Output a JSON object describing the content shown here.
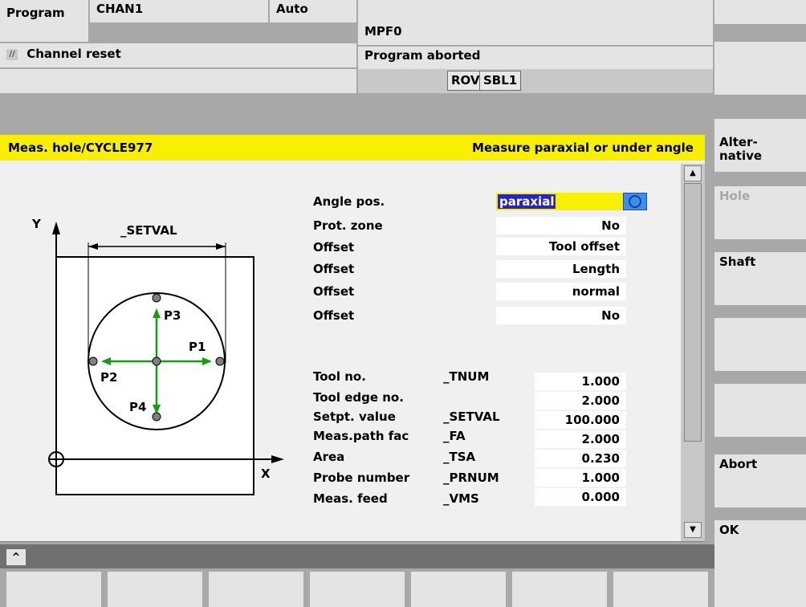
{
  "header": {
    "area": "Program",
    "channel": "CHAN1",
    "mode": "Auto",
    "program": "MPF0",
    "channel_status": "Channel reset",
    "program_status": "Program aborted",
    "flags": [
      "ROV",
      "SBL1"
    ]
  },
  "dialog": {
    "title": "Meas. hole/CYCLE977",
    "subtitle": "Measure paraxial or under angle",
    "graphic": {
      "y_label": "Y",
      "x_label": "X",
      "dim_label": "_SETVAL",
      "points": [
        "P1",
        "P2",
        "P3",
        "P4"
      ]
    },
    "params_top": [
      {
        "label": "Angle pos.",
        "value": "paraxial"
      },
      {
        "label": "Prot. zone",
        "value": "No"
      },
      {
        "label": "Offset",
        "value": "Tool offset"
      },
      {
        "label": "Offset",
        "value": "Length"
      },
      {
        "label": "Offset",
        "value": "normal"
      },
      {
        "label": "Offset",
        "value": "No"
      }
    ],
    "params_bottom": [
      {
        "label": "Tool no.",
        "var": "_TNUM",
        "value": "1.000"
      },
      {
        "label": "Tool edge no.",
        "var": "",
        "value": "2.000"
      },
      {
        "label": "Setpt. value",
        "var": "_SETVAL",
        "value": "100.000"
      },
      {
        "label": "Meas.path fac",
        "var": "_FA",
        "value": "2.000"
      },
      {
        "label": "Area",
        "var": "_TSA",
        "value": "0.230"
      },
      {
        "label": "Probe number",
        "var": "_PRNUM",
        "value": "1.000"
      },
      {
        "label": "Meas. feed",
        "var": "_VMS",
        "value": "0.000"
      }
    ]
  },
  "softkeys": {
    "s1": "",
    "s2": "",
    "alternative": "Alter-\nnative",
    "hole": "Hole",
    "shaft": "Shaft",
    "s6": "",
    "s7": "",
    "abort": "Abort",
    "ok": "OK"
  },
  "colors": {
    "title_bar": "#f8f000",
    "highlight": "#2424c8",
    "arrow": "#10a010",
    "toggle": "#3890e8"
  }
}
